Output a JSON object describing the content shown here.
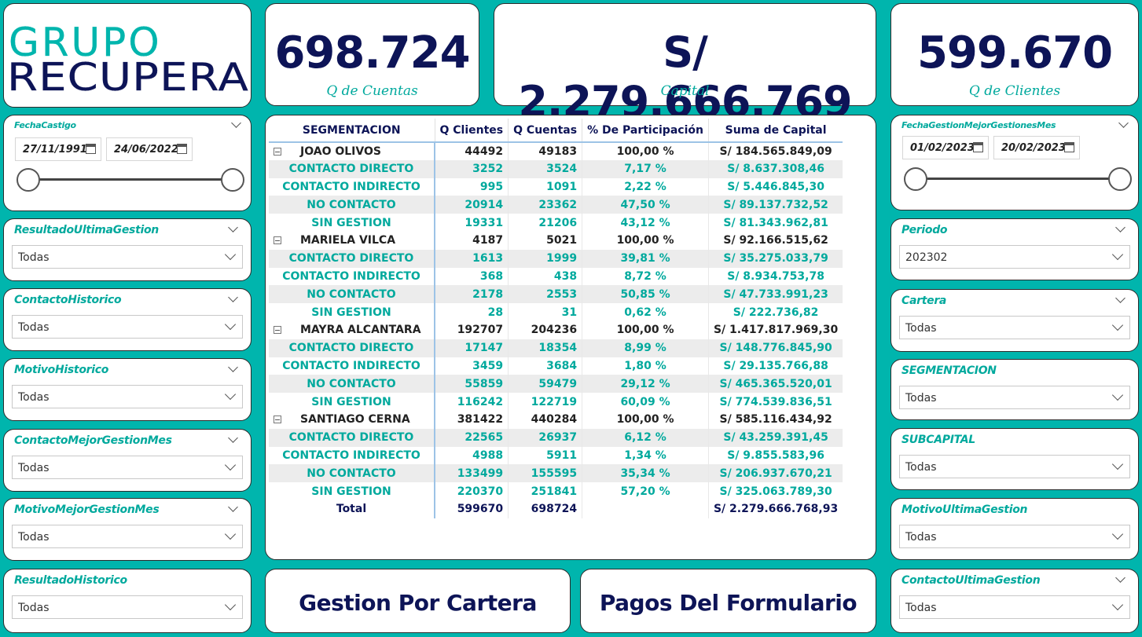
{
  "logo": {
    "line1": "GRUPO",
    "line2": "RECUPERA"
  },
  "kpis": {
    "cuentas": {
      "value": "698.724",
      "label": "Q de Cuentas"
    },
    "capital": {
      "value": "S/ 2.279.666.769",
      "label": "Capital"
    },
    "clientes": {
      "value": "599.670",
      "label": "Q de Clientes"
    }
  },
  "left_date_slicer": {
    "title": "FechaCastigo",
    "from": "27/11/1991",
    "to": "24/06/2022"
  },
  "right_date_slicer": {
    "title": "FechaGestionMejorGestionesMes",
    "from": "01/02/2023",
    "to": "20/02/2023"
  },
  "left_slicers": [
    {
      "title": "ResultadoUltimaGestion",
      "value": "Todas"
    },
    {
      "title": "ContactoHistorico",
      "value": "Todas"
    },
    {
      "title": "MotivoHistorico",
      "value": "Todas"
    },
    {
      "title": "ContactoMejorGestionMes",
      "value": "Todas"
    },
    {
      "title": "MotivoMejorGestionMes",
      "value": "Todas"
    },
    {
      "title": "ResultadoHistorico",
      "value": "Todas"
    }
  ],
  "right_slicers": [
    {
      "title": "Periodo",
      "value": "202302"
    },
    {
      "title": "Cartera",
      "value": "Todas"
    },
    {
      "title": "SEGMENTACION",
      "value": "Todas"
    },
    {
      "title": "SUBCAPITAL",
      "value": "Todas"
    },
    {
      "title": "MotivoUltimaGestion",
      "value": "Todas"
    },
    {
      "title": "ContactoUltimaGestion",
      "value": "Todas"
    }
  ],
  "table": {
    "headers": [
      "SEGMENTACION",
      "Q Clientes",
      "Q Cuentas",
      "% De Participación",
      "Suma de Capital"
    ],
    "rows": [
      {
        "kind": "grp",
        "name": "JOAO OLIVOS",
        "qc": "44492",
        "qa": "49183",
        "pct": "100,00 %",
        "cap": "S/ 184.565.849,09"
      },
      {
        "kind": "sub",
        "name": "CONTACTO DIRECTO",
        "qc": "3252",
        "qa": "3524",
        "pct": "7,17 %",
        "cap": "S/ 8.637.308,46"
      },
      {
        "kind": "sub",
        "name": "CONTACTO INDIRECTO",
        "qc": "995",
        "qa": "1091",
        "pct": "2,22 %",
        "cap": "S/ 5.446.845,30"
      },
      {
        "kind": "sub",
        "name": "NO CONTACTO",
        "qc": "20914",
        "qa": "23362",
        "pct": "47,50 %",
        "cap": "S/ 89.137.732,52"
      },
      {
        "kind": "sub",
        "name": "SIN GESTION",
        "qc": "19331",
        "qa": "21206",
        "pct": "43,12 %",
        "cap": "S/ 81.343.962,81"
      },
      {
        "kind": "grp",
        "name": "MARIELA VILCA",
        "qc": "4187",
        "qa": "5021",
        "pct": "100,00 %",
        "cap": "S/ 92.166.515,62"
      },
      {
        "kind": "sub",
        "name": "CONTACTO DIRECTO",
        "qc": "1613",
        "qa": "1999",
        "pct": "39,81 %",
        "cap": "S/ 35.275.033,79"
      },
      {
        "kind": "sub",
        "name": "CONTACTO INDIRECTO",
        "qc": "368",
        "qa": "438",
        "pct": "8,72 %",
        "cap": "S/ 8.934.753,78"
      },
      {
        "kind": "sub",
        "name": "NO CONTACTO",
        "qc": "2178",
        "qa": "2553",
        "pct": "50,85 %",
        "cap": "S/ 47.733.991,23"
      },
      {
        "kind": "sub",
        "name": "SIN GESTION",
        "qc": "28",
        "qa": "31",
        "pct": "0,62 %",
        "cap": "S/ 222.736,82"
      },
      {
        "kind": "grp",
        "name": "MAYRA ALCANTARA",
        "qc": "192707",
        "qa": "204236",
        "pct": "100,00 %",
        "cap": "S/ 1.417.817.969,30"
      },
      {
        "kind": "sub",
        "name": "CONTACTO DIRECTO",
        "qc": "17147",
        "qa": "18354",
        "pct": "8,99 %",
        "cap": "S/ 148.776.845,90"
      },
      {
        "kind": "sub",
        "name": "CONTACTO INDIRECTO",
        "qc": "3459",
        "qa": "3684",
        "pct": "1,80 %",
        "cap": "S/ 29.135.766,88"
      },
      {
        "kind": "sub",
        "name": "NO CONTACTO",
        "qc": "55859",
        "qa": "59479",
        "pct": "29,12 %",
        "cap": "S/ 465.365.520,01"
      },
      {
        "kind": "sub",
        "name": "SIN GESTION",
        "qc": "116242",
        "qa": "122719",
        "pct": "60,09 %",
        "cap": "S/ 774.539.836,51"
      },
      {
        "kind": "grp",
        "name": "SANTIAGO CERNA",
        "qc": "381422",
        "qa": "440284",
        "pct": "100,00 %",
        "cap": "S/ 585.116.434,92"
      },
      {
        "kind": "sub",
        "name": "CONTACTO DIRECTO",
        "qc": "22565",
        "qa": "26937",
        "pct": "6,12 %",
        "cap": "S/ 43.259.391,45"
      },
      {
        "kind": "sub",
        "name": "CONTACTO INDIRECTO",
        "qc": "4988",
        "qa": "5911",
        "pct": "1,34 %",
        "cap": "S/ 9.855.583,96"
      },
      {
        "kind": "sub",
        "name": "NO CONTACTO",
        "qc": "133499",
        "qa": "155595",
        "pct": "35,34 %",
        "cap": "S/ 206.937.670,21"
      },
      {
        "kind": "sub",
        "name": "SIN GESTION",
        "qc": "220370",
        "qa": "251841",
        "pct": "57,20 %",
        "cap": "S/ 325.063.789,30"
      },
      {
        "kind": "total",
        "name": "Total",
        "qc": "599670",
        "qa": "698724",
        "pct": "",
        "cap": "S/ 2.279.666.768,93"
      }
    ]
  },
  "buttons": {
    "gestion": "Gestion Por Cartera",
    "pagos": "Pagos Del Formulario"
  }
}
